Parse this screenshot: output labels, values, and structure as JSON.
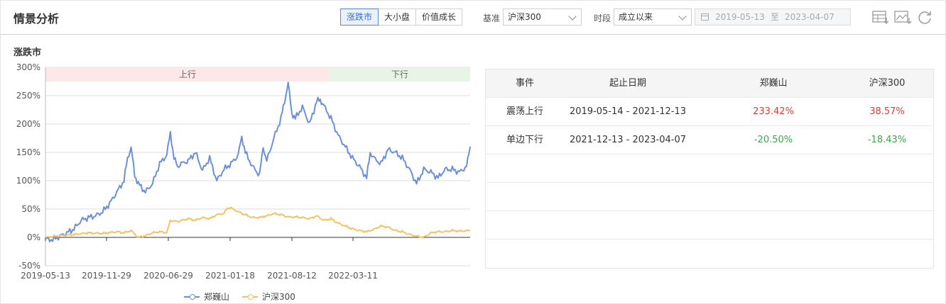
{
  "header": {
    "title": "情景分析",
    "segments": [
      "涨跌市",
      "大小盘",
      "价值成长"
    ],
    "active_segment": 0,
    "benchmark_label": "基准",
    "benchmark_value": "沪深300",
    "period_label": "时段",
    "period_value": "成立以来",
    "date_start": "2019-05-13",
    "date_sep": "至",
    "date_end": "2023-04-07",
    "tools": [
      "table-download-icon",
      "image-download-icon",
      "refresh-icon"
    ]
  },
  "section_title": "涨跌市",
  "chart_data": {
    "type": "line",
    "y_ticks": [
      "300%",
      "250%",
      "200%",
      "150%",
      "100%",
      "50%",
      "0%",
      "-50%"
    ],
    "ylim": [
      -50,
      300
    ],
    "x_ticks": [
      "2019-05-13",
      "2019-11-29",
      "2020-06-29",
      "2021-01-18",
      "2021-08-12",
      "2022-03-11"
    ],
    "regimes": [
      {
        "label": "上行",
        "color": "#fce8e8"
      },
      {
        "label": "下行",
        "color": "#e8f4e8"
      }
    ],
    "series": [
      {
        "name": "郑巍山",
        "color": "#6b8fdc",
        "points": [
          [
            0,
            -3
          ],
          [
            10,
            -4
          ],
          [
            20,
            2
          ],
          [
            30,
            8
          ],
          [
            40,
            15
          ],
          [
            50,
            30
          ],
          [
            60,
            35
          ],
          [
            70,
            38
          ],
          [
            80,
            45
          ],
          [
            90,
            60
          ],
          [
            100,
            80
          ],
          [
            110,
            100
          ],
          [
            115,
            140
          ],
          [
            120,
            158
          ],
          [
            125,
            110
          ],
          [
            130,
            95
          ],
          [
            140,
            80
          ],
          [
            150,
            95
          ],
          [
            160,
            130
          ],
          [
            170,
            145
          ],
          [
            175,
            185
          ],
          [
            180,
            140
          ],
          [
            185,
            125
          ],
          [
            190,
            130
          ],
          [
            200,
            135
          ],
          [
            210,
            150
          ],
          [
            220,
            118
          ],
          [
            230,
            140
          ],
          [
            240,
            100
          ],
          [
            250,
            120
          ],
          [
            260,
            130
          ],
          [
            270,
            145
          ],
          [
            275,
            178
          ],
          [
            280,
            150
          ],
          [
            290,
            125
          ],
          [
            300,
            110
          ],
          [
            305,
            160
          ],
          [
            310,
            135
          ],
          [
            320,
            175
          ],
          [
            330,
            210
          ],
          [
            335,
            240
          ],
          [
            340,
            272
          ],
          [
            345,
            220
          ],
          [
            350,
            210
          ],
          [
            360,
            230
          ],
          [
            370,
            200
          ],
          [
            380,
            240
          ],
          [
            385,
            243
          ],
          [
            390,
            232
          ],
          [
            400,
            210
          ],
          [
            410,
            180
          ],
          [
            420,
            160
          ],
          [
            430,
            140
          ],
          [
            440,
            125
          ],
          [
            450,
            105
          ],
          [
            455,
            150
          ],
          [
            460,
            140
          ],
          [
            470,
            130
          ],
          [
            480,
            155
          ],
          [
            490,
            150
          ],
          [
            500,
            140
          ],
          [
            510,
            120
          ],
          [
            520,
            95
          ],
          [
            530,
            120
          ],
          [
            540,
            115
          ],
          [
            550,
            105
          ],
          [
            560,
            120
          ],
          [
            570,
            120
          ],
          [
            580,
            115
          ],
          [
            590,
            125
          ],
          [
            595,
            160
          ]
        ]
      },
      {
        "name": "沪深300",
        "color": "#f5c164",
        "points": [
          [
            0,
            0
          ],
          [
            20,
            3
          ],
          [
            40,
            5
          ],
          [
            60,
            8
          ],
          [
            80,
            7
          ],
          [
            100,
            10
          ],
          [
            110,
            8
          ],
          [
            120,
            12
          ],
          [
            130,
            0
          ],
          [
            140,
            3
          ],
          [
            150,
            8
          ],
          [
            160,
            10
          ],
          [
            170,
            8
          ],
          [
            175,
            30
          ],
          [
            185,
            28
          ],
          [
            200,
            33
          ],
          [
            210,
            30
          ],
          [
            220,
            35
          ],
          [
            230,
            33
          ],
          [
            240,
            40
          ],
          [
            250,
            42
          ],
          [
            255,
            52
          ],
          [
            260,
            52
          ],
          [
            270,
            45
          ],
          [
            280,
            40
          ],
          [
            290,
            35
          ],
          [
            300,
            35
          ],
          [
            310,
            38
          ],
          [
            320,
            42
          ],
          [
            330,
            40
          ],
          [
            340,
            36
          ],
          [
            350,
            36
          ],
          [
            360,
            35
          ],
          [
            370,
            33
          ],
          [
            380,
            38
          ],
          [
            390,
            30
          ],
          [
            400,
            33
          ],
          [
            410,
            25
          ],
          [
            420,
            20
          ],
          [
            430,
            15
          ],
          [
            440,
            12
          ],
          [
            450,
            10
          ],
          [
            460,
            14
          ],
          [
            470,
            20
          ],
          [
            480,
            18
          ],
          [
            490,
            12
          ],
          [
            500,
            10
          ],
          [
            510,
            5
          ],
          [
            520,
            2
          ],
          [
            530,
            0
          ],
          [
            540,
            8
          ],
          [
            550,
            10
          ],
          [
            560,
            10
          ],
          [
            570,
            12
          ],
          [
            580,
            11
          ],
          [
            595,
            12
          ]
        ]
      }
    ]
  },
  "table": {
    "headers": [
      "事件",
      "起止日期",
      "郑巍山",
      "沪深300"
    ],
    "rows": [
      {
        "event": "震荡上行",
        "range": "2019-05-14 - 2021-12-13",
        "fund": "233.42%",
        "bench": "38.57%",
        "fund_sign": "pos",
        "bench_sign": "pos"
      },
      {
        "event": "单边下行",
        "range": "2021-12-13 - 2023-04-07",
        "fund": "-20.50%",
        "bench": "-18.43%",
        "fund_sign": "neg",
        "bench_sign": "neg"
      }
    ]
  },
  "legend": [
    {
      "name": "郑巍山",
      "color": "#6b8fdc"
    },
    {
      "name": "沪深300",
      "color": "#f5c164"
    }
  ]
}
